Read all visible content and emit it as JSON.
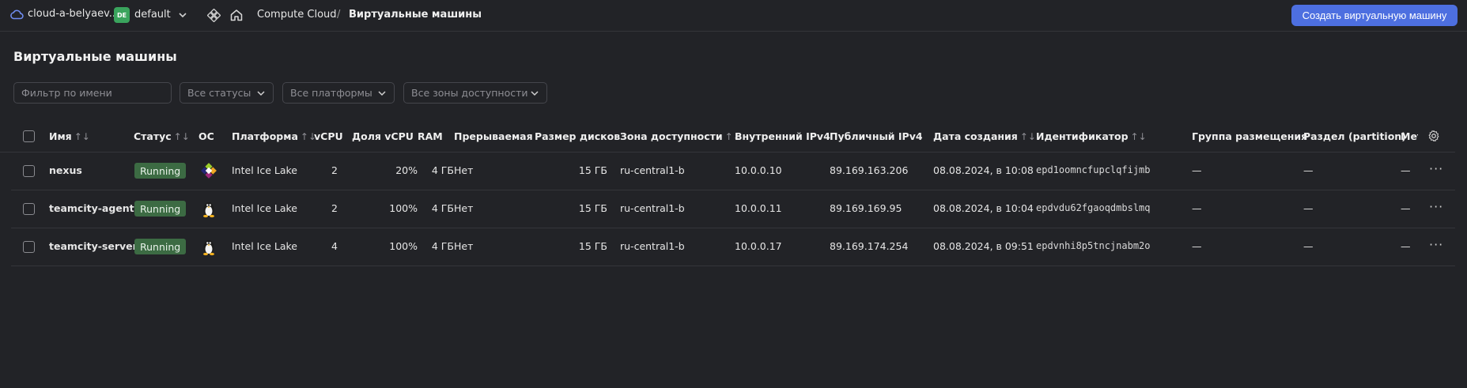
{
  "topbar": {
    "cloud_label": "cloud-a-belyaev...",
    "folder_badge": "DE",
    "folder_label": "default",
    "breadcrumb_service": "Compute Cloud",
    "breadcrumb_sep": "/",
    "breadcrumb_page": "Виртуальные машины",
    "create_button": "Создать виртуальную машину",
    "accent_color": "#4d6fe0"
  },
  "page": {
    "title": "Виртуальные машины"
  },
  "filters": {
    "name_placeholder": "Фильтр по имени",
    "status": "Все статусы",
    "platform": "Все платформы",
    "zone": "Все зоны доступности"
  },
  "columns": {
    "name": "Имя",
    "status": "Статус",
    "os": "ОС",
    "platform": "Платформа",
    "vcpu": "vCPU",
    "vcpu_share": "Доля vCPU",
    "ram": "RAM",
    "preemptible": "Прерываемая",
    "disk_size": "Размер дисков",
    "zone": "Зона доступности",
    "internal_ip": "Внутренний IPv4",
    "public_ip": "Публичный IPv4",
    "created": "Дата создания",
    "id": "Идентификатор",
    "placement_group": "Группа размещения",
    "partition": "Раздел (partition)",
    "meta": "Метки"
  },
  "rows": [
    {
      "name": "nexus",
      "status": "Running",
      "os_icon": "centos-icon",
      "platform": "Intel Ice Lake",
      "vcpu": "2",
      "vcpu_share": "20%",
      "ram": "4 ГБ",
      "preemptible": "Нет",
      "disk_size": "15 ГБ",
      "zone": "ru-central1-b",
      "internal_ip": "10.0.0.10",
      "public_ip": "89.169.163.206",
      "created": "08.08.2024, в 10:08",
      "id": "epd1oomncfupclqfijmb",
      "placement_group": "—",
      "partition": "—",
      "meta": "—"
    },
    {
      "name": "teamcity-agent",
      "status": "Running",
      "os_icon": "linux-tux-icon",
      "platform": "Intel Ice Lake",
      "vcpu": "2",
      "vcpu_share": "100%",
      "ram": "4 ГБ",
      "preemptible": "Нет",
      "disk_size": "15 ГБ",
      "zone": "ru-central1-b",
      "internal_ip": "10.0.0.11",
      "public_ip": "89.169.169.95",
      "created": "08.08.2024, в 10:04",
      "id": "epdvdu62fgaoqdmbslmq",
      "placement_group": "—",
      "partition": "—",
      "meta": "—"
    },
    {
      "name": "teamcity-server",
      "status": "Running",
      "os_icon": "linux-tux-icon",
      "platform": "Intel Ice Lake",
      "vcpu": "4",
      "vcpu_share": "100%",
      "ram": "4 ГБ",
      "preemptible": "Нет",
      "disk_size": "15 ГБ",
      "zone": "ru-central1-b",
      "internal_ip": "10.0.0.17",
      "public_ip": "89.169.174.254",
      "created": "08.08.2024, в 09:51",
      "id": "epdvnhi8p5tncjnabm2o",
      "placement_group": "—",
      "partition": "—",
      "meta": "—"
    }
  ],
  "more_actions": "···",
  "status_color": "#3c6b43"
}
